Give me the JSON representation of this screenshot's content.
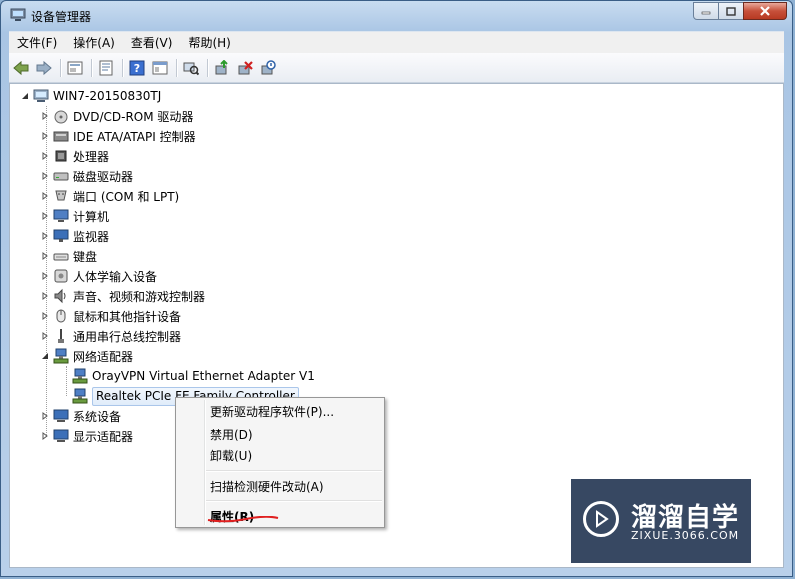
{
  "window": {
    "title": "设备管理器",
    "controls": [
      "minimize-icon",
      "maximize-icon",
      "close-icon"
    ]
  },
  "menu": [
    "文件(F)",
    "操作(A)",
    "查看(V)",
    "帮助(H)"
  ],
  "toolbar": [
    "back-icon",
    "forward-icon",
    "up-icon",
    "properties-icon",
    "help-icon",
    "view-icon",
    "scan-icon",
    "update-driver-icon",
    "uninstall-icon",
    "disable-icon"
  ],
  "tree": {
    "root": "WIN7-20150830TJ",
    "categories": [
      {
        "label": "DVD/CD-ROM 驱动器",
        "icon": "dvd-drive-icon"
      },
      {
        "label": "IDE ATA/ATAPI 控制器",
        "icon": "ide-controller-icon"
      },
      {
        "label": "处理器",
        "icon": "processor-icon"
      },
      {
        "label": "磁盘驱动器",
        "icon": "disk-drive-icon"
      },
      {
        "label": "端口 (COM 和 LPT)",
        "icon": "port-icon"
      },
      {
        "label": "计算机",
        "icon": "computer-icon"
      },
      {
        "label": "监视器",
        "icon": "monitor-icon"
      },
      {
        "label": "键盘",
        "icon": "keyboard-icon"
      },
      {
        "label": "人体学输入设备",
        "icon": "hid-icon"
      },
      {
        "label": "声音、视频和游戏控制器",
        "icon": "sound-icon"
      },
      {
        "label": "鼠标和其他指针设备",
        "icon": "mouse-icon"
      },
      {
        "label": "通用串行总线控制器",
        "icon": "usb-icon"
      },
      {
        "label": "网络适配器",
        "icon": "network-adapter-icon",
        "expanded": true
      },
      {
        "label": "系统设备",
        "icon": "system-device-icon"
      },
      {
        "label": "显示适配器",
        "icon": "display-adapter-icon"
      }
    ],
    "network_children": [
      {
        "label": "OrayVPN Virtual Ethernet Adapter V1"
      },
      {
        "label": "Realtek PCIe FE Family Controller",
        "selected": true
      }
    ]
  },
  "context_menu": {
    "items": [
      "更新驱动程序软件(P)...",
      "禁用(D)",
      "卸载(U)",
      "扫描检测硬件改动(A)",
      "属性(R)"
    ]
  },
  "watermark": {
    "title": "溜溜自学",
    "subtitle": "ZIXUE.3066.COM"
  }
}
